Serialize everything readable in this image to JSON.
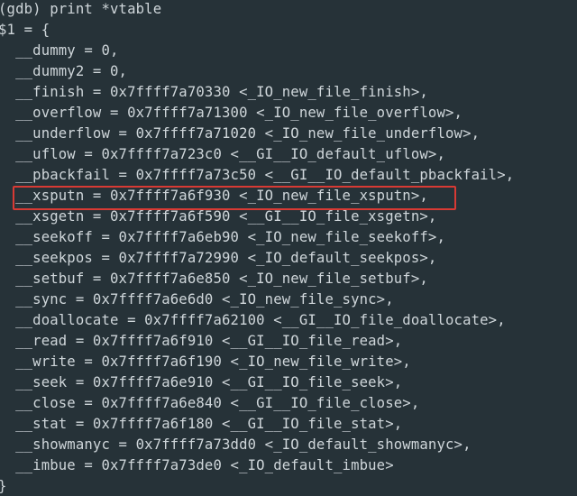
{
  "terminal": {
    "prompt_line": "(gdb) print *vtable",
    "result_open": "$1 = {",
    "entries": [
      "  __dummy = 0,",
      "  __dummy2 = 0,",
      "  __finish = 0x7ffff7a70330 <_IO_new_file_finish>,",
      "  __overflow = 0x7ffff7a71300 <_IO_new_file_overflow>,",
      "  __underflow = 0x7ffff7a71020 <_IO_new_file_underflow>,",
      "  __uflow = 0x7ffff7a723c0 <__GI__IO_default_uflow>,",
      "  __pbackfail = 0x7ffff7a73c50 <__GI__IO_default_pbackfail>,",
      "  __xsputn = 0x7ffff7a6f930 <_IO_new_file_xsputn>,",
      "  __xsgetn = 0x7ffff7a6f590 <__GI__IO_file_xsgetn>,",
      "  __seekoff = 0x7ffff7a6eb90 <_IO_new_file_seekoff>,",
      "  __seekpos = 0x7ffff7a72990 <_IO_default_seekpos>,",
      "  __setbuf = 0x7ffff7a6e850 <_IO_new_file_setbuf>,",
      "  __sync = 0x7ffff7a6e6d0 <_IO_new_file_sync>,",
      "  __doallocate = 0x7ffff7a62100 <__GI__IO_file_doallocate>,",
      "  __read = 0x7ffff7a6f910 <__GI__IO_file_read>,",
      "  __write = 0x7ffff7a6f190 <_IO_new_file_write>,",
      "  __seek = 0x7ffff7a6e910 <__GI__IO_file_seek>,",
      "  __close = 0x7ffff7a6e840 <__GI__IO_file_close>,",
      "  __stat = 0x7ffff7a6f180 <__GI__IO_file_stat>,",
      "  __showmanyc = 0x7ffff7a73dd0 <_IO_default_showmanyc>,",
      "  __imbue = 0x7ffff7a73de0 <_IO_default_imbue>"
    ],
    "result_close": "}",
    "highlight_color": "#d83a34",
    "background_color": "#263238",
    "text_color": "#cfd6da"
  }
}
